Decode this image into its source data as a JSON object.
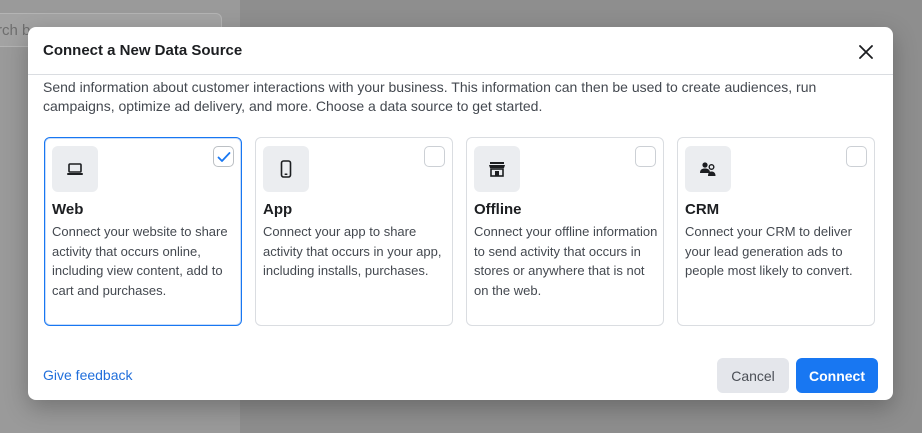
{
  "background": {
    "search_text": "rch b"
  },
  "modal": {
    "title": "Connect a New Data Source",
    "close_icon": "close-icon",
    "description": "Send information about customer interactions with your business. This information can then be used to create audiences, run campaigns, optimize ad delivery, and more. Choose a data source to get started.",
    "cards": [
      {
        "title": "Web",
        "icon": "laptop-icon",
        "selected": true,
        "desc": "Connect your website to share activity that occurs online, including view content, add to cart and purchases."
      },
      {
        "title": "App",
        "icon": "mobile-phone-icon",
        "selected": false,
        "desc": "Connect your app to share activity that occurs in your app, including installs, purchases."
      },
      {
        "title": "Offline",
        "icon": "store-icon",
        "selected": false,
        "desc": "Connect your offline information to send activity that occurs in stores or anywhere that is not on the web."
      },
      {
        "title": "CRM",
        "icon": "people-icon",
        "selected": false,
        "desc": "Connect your CRM to deliver your lead generation ads to people most likely to convert."
      }
    ],
    "feedback_link": "Give feedback",
    "cancel_label": "Cancel",
    "connect_label": "Connect"
  },
  "colors": {
    "accent": "#1877f2",
    "link": "#216fdb",
    "overlay": "#8e8e8e"
  }
}
